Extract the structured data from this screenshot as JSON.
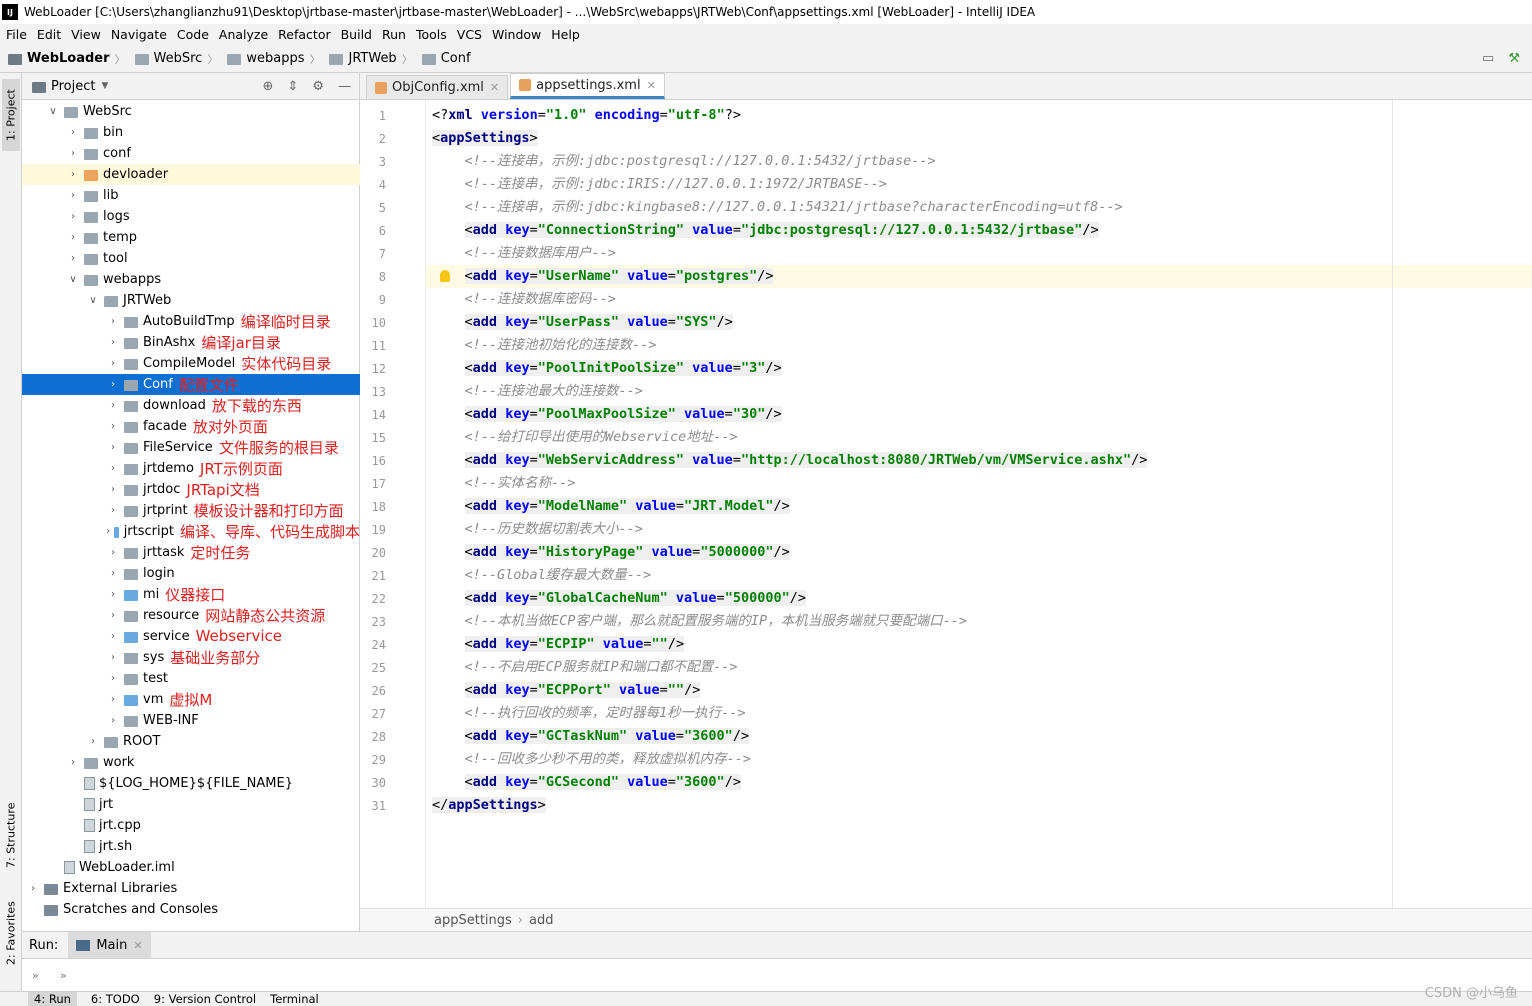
{
  "window": {
    "title": "WebLoader [C:\\Users\\zhanglianzhu91\\Desktop\\jrtbase-master\\jrtbase-master\\WebLoader] - ...\\WebSrc\\webapps\\JRTWeb\\Conf\\appsettings.xml [WebLoader] - IntelliJ IDEA",
    "logo": "IJ"
  },
  "menu": [
    "File",
    "Edit",
    "View",
    "Navigate",
    "Code",
    "Analyze",
    "Refactor",
    "Build",
    "Run",
    "Tools",
    "VCS",
    "Window",
    "Help"
  ],
  "breadcrumb": [
    "WebLoader",
    "WebSrc",
    "webapps",
    "JRTWeb",
    "Conf"
  ],
  "left_strip": {
    "project": "1: Project",
    "structure": "7: Structure",
    "favorites": "2: Favorites"
  },
  "project_panel": {
    "title": "Project",
    "rows": [
      {
        "label": "WebSrc",
        "arrow": "∨",
        "indent": 1,
        "kind": "folder",
        "ann": ""
      },
      {
        "label": "bin",
        "arrow": "›",
        "indent": 2,
        "kind": "folder",
        "ann": ""
      },
      {
        "label": "conf",
        "arrow": "›",
        "indent": 2,
        "kind": "folder",
        "ann": ""
      },
      {
        "label": "devloader",
        "arrow": "›",
        "indent": 2,
        "kind": "orange",
        "ann": ""
      },
      {
        "label": "lib",
        "arrow": "›",
        "indent": 2,
        "kind": "folder",
        "ann": ""
      },
      {
        "label": "logs",
        "arrow": "›",
        "indent": 2,
        "kind": "folder",
        "ann": ""
      },
      {
        "label": "temp",
        "arrow": "›",
        "indent": 2,
        "kind": "folder",
        "ann": ""
      },
      {
        "label": "tool",
        "arrow": "›",
        "indent": 2,
        "kind": "folder",
        "ann": ""
      },
      {
        "label": "webapps",
        "arrow": "∨",
        "indent": 2,
        "kind": "folder",
        "ann": ""
      },
      {
        "label": "JRTWeb",
        "arrow": "∨",
        "indent": 3,
        "kind": "folder",
        "ann": ""
      },
      {
        "label": "AutoBuildTmp",
        "arrow": "›",
        "indent": 4,
        "kind": "folder",
        "ann": "编译临时目录"
      },
      {
        "label": "BinAshx",
        "arrow": "›",
        "indent": 4,
        "kind": "folder",
        "ann": "编译jar目录"
      },
      {
        "label": "CompileModel",
        "arrow": "›",
        "indent": 4,
        "kind": "folder",
        "ann": "实体代码目录"
      },
      {
        "label": "Conf",
        "arrow": "›",
        "indent": 4,
        "kind": "folder",
        "ann": "配置文件"
      },
      {
        "label": "download",
        "arrow": "›",
        "indent": 4,
        "kind": "folder",
        "ann": "放下载的东西"
      },
      {
        "label": "facade",
        "arrow": "›",
        "indent": 4,
        "kind": "folder",
        "ann": "放对外页面"
      },
      {
        "label": "FileService",
        "arrow": "›",
        "indent": 4,
        "kind": "folder",
        "ann": "文件服务的根目录"
      },
      {
        "label": "jrtdemo",
        "arrow": "›",
        "indent": 4,
        "kind": "folder",
        "ann": "JRT示例页面"
      },
      {
        "label": "jrtdoc",
        "arrow": "›",
        "indent": 4,
        "kind": "folder",
        "ann": "JRTapi文档"
      },
      {
        "label": "jrtprint",
        "arrow": "›",
        "indent": 4,
        "kind": "folder",
        "ann": "模板设计器和打印方面"
      },
      {
        "label": "jrtscript",
        "arrow": "›",
        "indent": 4,
        "kind": "blue",
        "ann": "编译、导库、代码生成脚本"
      },
      {
        "label": "jrttask",
        "arrow": "›",
        "indent": 4,
        "kind": "folder",
        "ann": "定时任务"
      },
      {
        "label": "login",
        "arrow": "›",
        "indent": 4,
        "kind": "folder",
        "ann": ""
      },
      {
        "label": "mi",
        "arrow": "›",
        "indent": 4,
        "kind": "blue",
        "ann": "仪器接口"
      },
      {
        "label": "resource",
        "arrow": "›",
        "indent": 4,
        "kind": "folder",
        "ann": "网站静态公共资源"
      },
      {
        "label": "service",
        "arrow": "›",
        "indent": 4,
        "kind": "blue",
        "ann": "Webservice"
      },
      {
        "label": "sys",
        "arrow": "›",
        "indent": 4,
        "kind": "folder",
        "ann": "基础业务部分"
      },
      {
        "label": "test",
        "arrow": "›",
        "indent": 4,
        "kind": "folder",
        "ann": ""
      },
      {
        "label": "vm",
        "arrow": "›",
        "indent": 4,
        "kind": "blue",
        "ann": "虚拟M"
      },
      {
        "label": "WEB-INF",
        "arrow": "›",
        "indent": 4,
        "kind": "folder",
        "ann": ""
      },
      {
        "label": "ROOT",
        "arrow": "›",
        "indent": 3,
        "kind": "folder",
        "ann": ""
      },
      {
        "label": "work",
        "arrow": "›",
        "indent": 2,
        "kind": "folder",
        "ann": ""
      },
      {
        "label": "${LOG_HOME}${FILE_NAME}",
        "arrow": "",
        "indent": 2,
        "kind": "file",
        "ann": ""
      },
      {
        "label": "jrt",
        "arrow": "",
        "indent": 2,
        "kind": "file",
        "ann": ""
      },
      {
        "label": "jrt.cpp",
        "arrow": "",
        "indent": 2,
        "kind": "file",
        "ann": ""
      },
      {
        "label": "jrt.sh",
        "arrow": "",
        "indent": 2,
        "kind": "file",
        "ann": ""
      },
      {
        "label": "WebLoader.iml",
        "arrow": "",
        "indent": 1,
        "kind": "file",
        "ann": ""
      },
      {
        "label": "External Libraries",
        "arrow": "›",
        "indent": 0,
        "kind": "lib",
        "ann": ""
      },
      {
        "label": "Scratches and Consoles",
        "arrow": "",
        "indent": 0,
        "kind": "lib",
        "ann": ""
      }
    ]
  },
  "tabs": [
    {
      "label": "ObjConfig.xml",
      "active": false
    },
    {
      "label": "appsettings.xml",
      "active": true
    }
  ],
  "code_lines": [
    {
      "n": "1",
      "html": "<span class='punct'>&lt;?</span><span class='kw'>xml</span> <span class='att'>version</span>=<span class='val'>\"1.0\"</span> <span class='att'>encoding</span>=<span class='val'>\"utf-8\"</span><span class='punct'>?&gt;</span>"
    },
    {
      "n": "2",
      "html": "<span class='tagbox'>&lt;<span class='kw'>appSettings</span>&gt;</span>"
    },
    {
      "n": "3",
      "html": "    <span class='cmt'>&lt;!--连接串，示例:jdbc:postgresql://127.0.0.1:5432/jrtbase--&gt;</span>"
    },
    {
      "n": "4",
      "html": "    <span class='cmt'>&lt;!--连接串，示例:jdbc:IRIS://127.0.0.1:1972/JRTBASE--&gt;</span>"
    },
    {
      "n": "5",
      "html": "    <span class='cmt'>&lt;!--连接串，示例:jdbc:kingbase8://127.0.0.1:54321/jrtbase?characterEncoding=utf8--&gt;</span>"
    },
    {
      "n": "6",
      "html": "    <span class='tagbox'>&lt;<span class='kw'>add</span> <span class='att'>key</span>=<span class='val'>\"ConnectionString\"</span> <span class='att'>value</span>=<span class='val'>\"jdbc:postgresql://127.0.0.1:5432/jrtbase\"</span>/&gt;</span>"
    },
    {
      "n": "7",
      "html": "    <span class='cmt'>&lt;!--连接数据库用户--&gt;</span>"
    },
    {
      "n": "8",
      "html": "    <span class='tagbox'>&lt;<span class='kw'>add</span> <span class='att'>key</span>=<span class='val'>\"UserName\"</span> <span class='att'>value</span>=<span class='val'>\"postgres\"</span>/&gt;</span>"
    },
    {
      "n": "9",
      "html": "    <span class='cmt'>&lt;!--连接数据库密码--&gt;</span>"
    },
    {
      "n": "10",
      "html": "    <span class='tagbox'>&lt;<span class='kw'>add</span> <span class='att'>key</span>=<span class='val'>\"UserPass\"</span> <span class='att'>value</span>=<span class='val'>\"SYS\"</span>/&gt;</span>"
    },
    {
      "n": "11",
      "html": "    <span class='cmt'>&lt;!--连接池初始化的连接数--&gt;</span>"
    },
    {
      "n": "12",
      "html": "    <span class='tagbox'>&lt;<span class='kw'>add</span> <span class='att'>key</span>=<span class='val'>\"PoolInitPoolSize\"</span> <span class='att'>value</span>=<span class='val'>\"3\"</span>/&gt;</span>"
    },
    {
      "n": "13",
      "html": "    <span class='cmt'>&lt;!--连接池最大的连接数--&gt;</span>"
    },
    {
      "n": "14",
      "html": "    <span class='tagbox'>&lt;<span class='kw'>add</span> <span class='att'>key</span>=<span class='val'>\"PoolMaxPoolSize\"</span> <span class='att'>value</span>=<span class='val'>\"30\"</span>/&gt;</span>"
    },
    {
      "n": "15",
      "html": "    <span class='cmt'>&lt;!--给打印导出使用的Webservice地址--&gt;</span>"
    },
    {
      "n": "16",
      "html": "    <span class='tagbox'>&lt;<span class='kw'>add</span> <span class='att'>key</span>=<span class='val'>\"WebServicAddress\"</span> <span class='att'>value</span>=<span class='val'>\"http://localhost:8080/JRTWeb/vm/VMService.ashx\"</span>/&gt;</span>"
    },
    {
      "n": "17",
      "html": "    <span class='cmt'>&lt;!--实体名称--&gt;</span>"
    },
    {
      "n": "18",
      "html": "    <span class='tagbox'>&lt;<span class='kw'>add</span> <span class='att'>key</span>=<span class='val'>\"ModelName\"</span> <span class='att'>value</span>=<span class='val'>\"JRT.Model\"</span>/&gt;</span>"
    },
    {
      "n": "19",
      "html": "    <span class='cmt'>&lt;!--历史数据切割表大小--&gt;</span>"
    },
    {
      "n": "20",
      "html": "    <span class='tagbox'>&lt;<span class='kw'>add</span> <span class='att'>key</span>=<span class='val'>\"HistoryPage\"</span> <span class='att'>value</span>=<span class='val'>\"5000000\"</span>/&gt;</span>"
    },
    {
      "n": "21",
      "html": "    <span class='cmt'>&lt;!--Global缓存最大数量--&gt;</span>"
    },
    {
      "n": "22",
      "html": "    <span class='tagbox'>&lt;<span class='kw'>add</span> <span class='att'>key</span>=<span class='val'>\"GlobalCacheNum\"</span> <span class='att'>value</span>=<span class='val'>\"500000\"</span>/&gt;</span>"
    },
    {
      "n": "23",
      "html": "    <span class='cmt'>&lt;!--本机当做ECP客户端，那么就配置服务端的IP，本机当服务端就只要配端口--&gt;</span>"
    },
    {
      "n": "24",
      "html": "    <span class='tagbox'>&lt;<span class='kw'>add</span> <span class='att'>key</span>=<span class='val'>\"ECPIP\"</span> <span class='att'>value</span>=<span class='val'>\"\"</span>/&gt;</span>"
    },
    {
      "n": "25",
      "html": "    <span class='cmt'>&lt;!--不启用ECP服务就IP和端口都不配置--&gt;</span>"
    },
    {
      "n": "26",
      "html": "    <span class='tagbox'>&lt;<span class='kw'>add</span> <span class='att'>key</span>=<span class='val'>\"ECPPort\"</span> <span class='att'>value</span>=<span class='val'>\"\"</span>/&gt;</span>"
    },
    {
      "n": "27",
      "html": "    <span class='cmt'>&lt;!--执行回收的频率，定时器每1秒一执行--&gt;</span>"
    },
    {
      "n": "28",
      "html": "    <span class='tagbox'>&lt;<span class='kw'>add</span> <span class='att'>key</span>=<span class='val'>\"GCTaskNum\"</span> <span class='att'>value</span>=<span class='val'>\"3600\"</span>/&gt;</span>"
    },
    {
      "n": "29",
      "html": "    <span class='cmt'>&lt;!--回收多少秒不用的类，释放虚拟机内存--&gt;</span>"
    },
    {
      "n": "30",
      "html": "    <span class='tagbox'>&lt;<span class='kw'>add</span> <span class='att'>key</span>=<span class='val'>\"GCSecond\"</span> <span class='att'>value</span>=<span class='val'>\"3600\"</span>/&gt;</span>"
    },
    {
      "n": "31",
      "html": "<span class='tagbox'>&lt;/<span class='kw'>appSettings</span>&gt;</span>"
    }
  ],
  "editor_breadcrumb": [
    "appSettings",
    "add"
  ],
  "run": {
    "label": "Run:",
    "tab": "Main"
  },
  "status": [
    "4: Run",
    "6: TODO",
    "9: Version Control",
    "Terminal"
  ],
  "watermark": "CSDN @小乌鱼"
}
